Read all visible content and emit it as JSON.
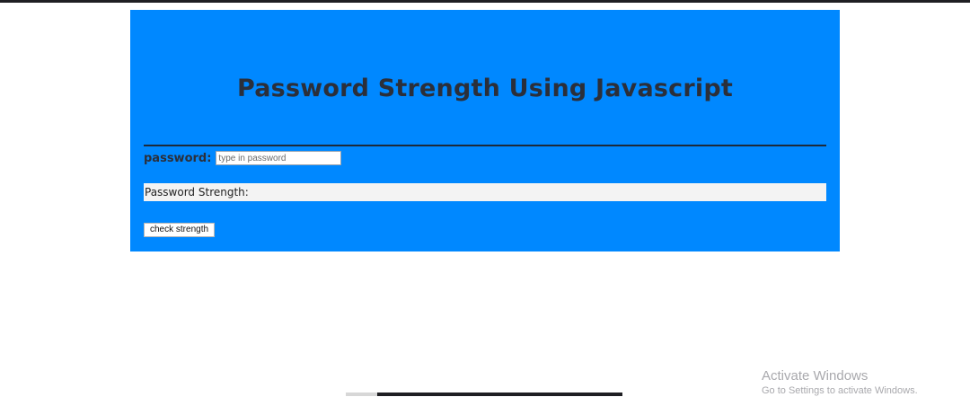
{
  "page": {
    "title": "Password Strength Using Javascript",
    "colors": {
      "panel_bg": "#0088ff",
      "title_color": "#2b2f3a",
      "strength_bg": "#f3f3f3"
    }
  },
  "form": {
    "password_label": "password:",
    "password_placeholder": "type in password",
    "password_value": "",
    "strength_label": "Password Strength:",
    "strength_value": "",
    "check_button_label": "check strength"
  },
  "watermark": {
    "title": "Activate Windows",
    "subtitle": "Go to Settings to activate Windows."
  }
}
